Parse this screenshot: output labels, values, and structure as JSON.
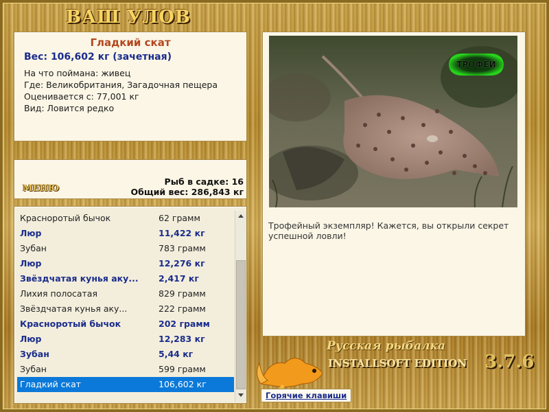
{
  "window": {
    "title": "ВАШ УЛОВ"
  },
  "catch": {
    "name": "Гладкий скат",
    "weight_line": "Вес: 106,602 кг (зачетная)",
    "bait_line": "На что поймана: живец",
    "where_line": "Где: Великобритания, Загадочная пещера",
    "value_line": "Оценивается с: 77,001 кг",
    "kind_line": "Вид: Ловится редко"
  },
  "menu": {
    "label": "МЕНЮ"
  },
  "stats": {
    "fish_count": "Рыб в садке: 16",
    "total_weight": "Общий вес: 286,843 кг"
  },
  "list": [
    {
      "name": "Красноротый бычок",
      "weight": "62 грамм",
      "bold": false
    },
    {
      "name": "Люр",
      "weight": "11,422 кг",
      "bold": true
    },
    {
      "name": "Зубан",
      "weight": "783 грамм",
      "bold": false
    },
    {
      "name": "Люр",
      "weight": "12,276 кг",
      "bold": true
    },
    {
      "name": "Звёздчатая кунья аку...",
      "weight": "2,417 кг",
      "bold": true
    },
    {
      "name": "Лихия полосатая",
      "weight": "829 грамм",
      "bold": false
    },
    {
      "name": "Звёздчатая кунья аку...",
      "weight": "222 грамм",
      "bold": false
    },
    {
      "name": "Красноротый бычок",
      "weight": "202 грамм",
      "bold": true
    },
    {
      "name": "Люр",
      "weight": "12,283 кг",
      "bold": true
    },
    {
      "name": "Зубан",
      "weight": "5,44 кг",
      "bold": true
    },
    {
      "name": "Зубан",
      "weight": "599 грамм",
      "bold": false
    },
    {
      "name": "Гладкий скат",
      "weight": "106,602 кг",
      "bold": false,
      "selected": true
    }
  ],
  "photo": {
    "badge": "ТРОФЕЙ"
  },
  "caption": "Трофейный экземпляр! Кажется, вы открыли секрет успешной ловли!",
  "brand": {
    "line1": "Русская рыбалка",
    "line2": "INSTALLSOFT EDITION",
    "version": "3.7.6"
  },
  "hotkeys": {
    "label": "Горячие клавиши"
  },
  "icons": {
    "scroll_up": "chevron-up-icon",
    "scroll_down": "chevron-down-icon",
    "logo": "goldfish-icon"
  }
}
